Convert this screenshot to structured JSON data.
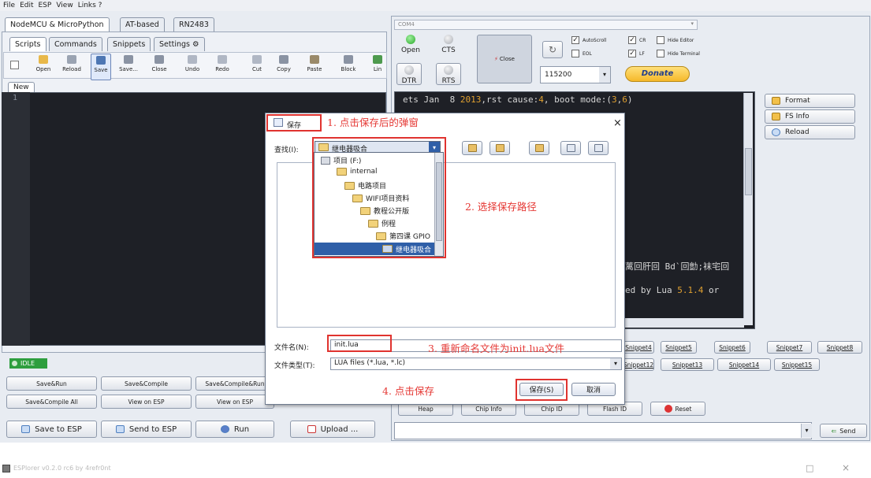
{
  "menubar": [
    "File",
    "Edit",
    "ESP",
    "View",
    "Links ?"
  ],
  "top_tabs": [
    "NodeMCU & MicroPython",
    "AT-based",
    "RN2483"
  ],
  "sub_tabs": [
    "Scripts",
    "Commands",
    "Snippets",
    "Settings"
  ],
  "toolbar": [
    "Open",
    "Reload",
    "Save",
    "Save...",
    "Close",
    "Undo",
    "Redo",
    "Cut",
    "Copy",
    "Paste",
    "Block",
    "Lin"
  ],
  "file_tab": "New",
  "line_number": "1",
  "status_idle": "IDLE",
  "left_buttons_row1": [
    "Save&Run",
    "Save&Compile",
    "Save&Compile&Run"
  ],
  "left_buttons_row2": [
    "Save&Compile All",
    "View on ESP",
    "View on ESP"
  ],
  "left_buttons_row3": [
    "Save to ESP",
    "Send to ESP",
    "Run",
    "Upload ..."
  ],
  "port": "COM4",
  "serial": {
    "open": "Open",
    "cts": "CTS",
    "dtr": "DTR",
    "rts": "RTS",
    "close": "Close",
    "baud": "115200",
    "donate": "Donate",
    "checks": [
      {
        "label": "AutoScroll",
        "checked": true
      },
      {
        "label": "CR",
        "checked": true
      },
      {
        "label": "Hide Editor",
        "checked": false
      },
      {
        "label": "EOL",
        "checked": false
      },
      {
        "label": "LF",
        "checked": true
      },
      {
        "label": "Hide Terminal",
        "checked": false
      }
    ]
  },
  "terminal": {
    "line1_a": "ets Jan  8 ",
    "line1_b": "2013",
    "line1_c": ",rst cause:",
    "line1_d": "4",
    "line1_e": ", boot mode:(",
    "line1_f": "3",
    "line1_g": ",",
    "line1_h": "6",
    "line1_i": ")",
    "garbled": "蓠回肝回 Bd`回勯;袜宅回",
    "lua_a": "ed by Lua ",
    "lua_b": "5.1.4",
    "lua_c": " or"
  },
  "side_buttons": [
    "Format",
    "FS Info",
    "Reload"
  ],
  "snippets_row1": [
    "Snippet4",
    "Snippet5",
    "Snippet6",
    "Snippet7",
    "Snippet8"
  ],
  "snippets_row2": [
    "Snippet12",
    "Snippet13",
    "Snippet14",
    "Snippet15"
  ],
  "bottom_right_buttons": [
    "Heap",
    "Chip Info",
    "Chip ID",
    "Flash ID",
    "Reset"
  ],
  "send_label": "Send",
  "dialog": {
    "title": "保存",
    "close": "×",
    "look_in_label": "查找(I):",
    "look_in_value": "继电器吸合",
    "tree": [
      "项目 (F:)",
      "internal",
      "电路项目",
      "WIFI项目资料",
      "教程公开版",
      "例程",
      "第四课 GPIO",
      "继电器吸合"
    ],
    "filename_label": "文件名(N):",
    "filename_value": "init.lua",
    "filetype_label": "文件类型(T):",
    "filetype_value": "LUA files (*.lua, *.lc)",
    "save_button": "保存(S)",
    "cancel_button": "取消"
  },
  "annotations": [
    "1. 点击保存后的弹窗",
    "2. 选择保存路径",
    "3. 重新命名文件为init.lua文件",
    "4. 点击保存"
  ],
  "colors": {
    "annotation": "#e53935",
    "terminal_bg": "#1e2026",
    "number": "#e0a030",
    "idle": "#2e9e3e",
    "donate": "#f5c542"
  },
  "second_window_title": "ESPlorer v0.2.0 rc6 by 4refr0nt",
  "window_controls": [
    "□",
    "×"
  ]
}
